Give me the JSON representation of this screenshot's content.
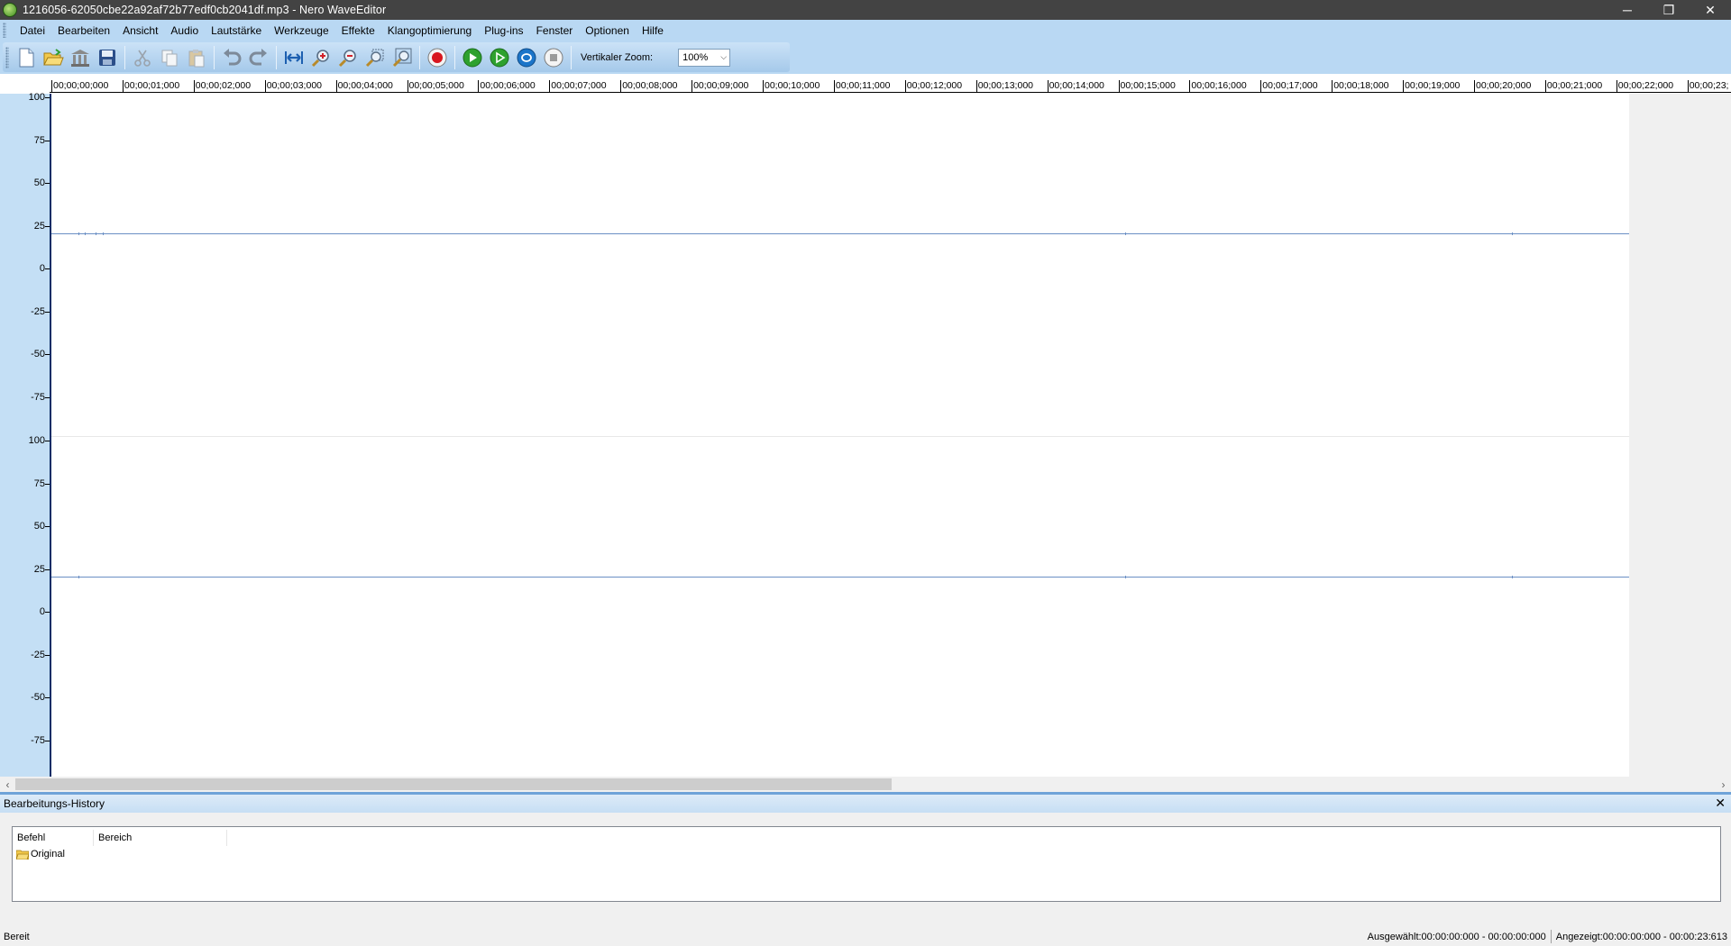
{
  "window": {
    "title": "1216056-62050cbe22a92af72b77edf0cb2041df.mp3 - Nero WaveEditor",
    "controls": {
      "minimize": "─",
      "restore": "❐",
      "close": "✕"
    }
  },
  "menu": [
    "Datei",
    "Bearbeiten",
    "Ansicht",
    "Audio",
    "Lautstärke",
    "Werkzeuge",
    "Effekte",
    "Klangoptimierung",
    "Plug-ins",
    "Fenster",
    "Optionen",
    "Hilfe"
  ],
  "toolbar": {
    "zoom_label": "Vertikaler Zoom:",
    "zoom_value": "100%",
    "buttons": [
      "new-file-icon",
      "open-folder-icon",
      "library-icon",
      "save-icon",
      "cut-icon",
      "copy-icon",
      "paste-icon",
      "undo-icon",
      "redo-icon",
      "fit-width-icon",
      "zoom-in-icon",
      "zoom-out-icon",
      "zoom-selection-icon",
      "zoom-fit-icon",
      "record-icon",
      "play-icon",
      "play-selection-icon",
      "loop-icon",
      "stop-icon"
    ]
  },
  "ruler": {
    "labels": [
      "00;00;00;000",
      "00;00;01;000",
      "00;00;02;000",
      "00;00;03;000",
      "00;00;04;000",
      "00;00;05;000",
      "00;00;06;000",
      "00;00;07;000",
      "00;00;08;000",
      "00;00;09;000",
      "00;00;10;000",
      "00;00;11;000",
      "00;00;12;000",
      "00;00;13;000",
      "00;00;14;000",
      "00;00;15;000",
      "00;00;16;000",
      "00;00;17;000",
      "00;00;18;000",
      "00;00;19;000",
      "00;00;20;000",
      "00;00;21;000",
      "00;00;22;000",
      "00;00;23;"
    ]
  },
  "amplitude_axis": {
    "channel1": [
      "100",
      "75",
      "50",
      "25",
      "0",
      "-25",
      "-50",
      "-75"
    ],
    "channel2": [
      "100",
      "75",
      "50",
      "25",
      "0",
      "-25",
      "-50",
      "-75"
    ]
  },
  "scrollbar": {
    "left_arrow": "‹",
    "right_arrow": "›"
  },
  "history": {
    "title": "Bearbeitungs-History",
    "close": "✕",
    "columns": [
      "Befehl",
      "Bereich"
    ],
    "rows": [
      "Original"
    ]
  },
  "status": {
    "left": "Bereit",
    "selected": "Ausgewählt:00:00:00:000 - 00:00:00:000",
    "shown": "Angezeigt:00:00:00:000 - 00:00:23:613"
  },
  "colors": {
    "titlebar": "#434343",
    "menubar": "#b9d8f3",
    "axis_panel": "#c4dff5",
    "waveform": "#6b8fc4"
  }
}
